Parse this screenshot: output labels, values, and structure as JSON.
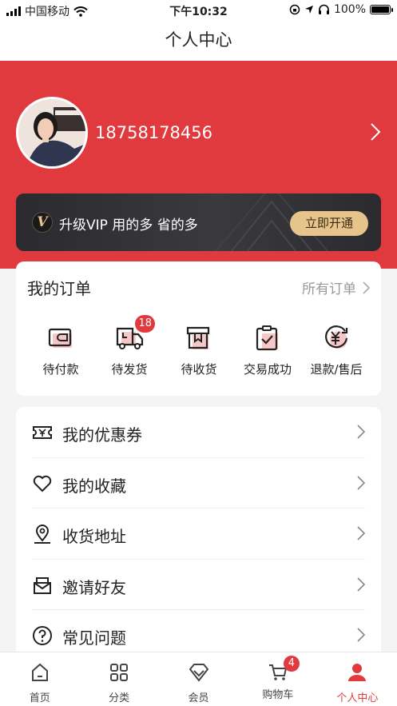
{
  "status_bar": {
    "carrier": "中国移动",
    "time": "下午10:32",
    "battery": "100%"
  },
  "nav": {
    "title": "个人中心"
  },
  "profile": {
    "phone": "18758178456"
  },
  "vip": {
    "logo": "V",
    "text": "升级VIP 用的多 省的多",
    "button": "立即开通"
  },
  "orders": {
    "title": "我的订单",
    "all_label": "所有订单",
    "items": [
      {
        "label": "待付款",
        "icon": "wallet-icon"
      },
      {
        "label": "待发货",
        "icon": "truck-icon",
        "badge": "18"
      },
      {
        "label": "待收货",
        "icon": "package-icon"
      },
      {
        "label": "交易成功",
        "icon": "clipboard-check-icon"
      },
      {
        "label": "退款/售后",
        "icon": "refund-icon"
      }
    ]
  },
  "menu": [
    {
      "label": "我的优惠券",
      "icon": "coupon-icon"
    },
    {
      "label": "我的收藏",
      "icon": "heart-icon"
    },
    {
      "label": "收货地址",
      "icon": "location-icon"
    },
    {
      "label": "邀请好友",
      "icon": "invite-icon"
    },
    {
      "label": "常见问题",
      "icon": "question-icon"
    }
  ],
  "tabbar": {
    "items": [
      {
        "label": "首页",
        "icon": "home-icon"
      },
      {
        "label": "分类",
        "icon": "category-icon"
      },
      {
        "label": "会员",
        "icon": "diamond-icon"
      },
      {
        "label": "购物车",
        "icon": "cart-icon",
        "badge": "4"
      },
      {
        "label": "个人中心",
        "icon": "user-icon",
        "active": true
      }
    ]
  },
  "colors": {
    "brand_red": "#e03a3e",
    "vip_gold": "#e7c48c",
    "vip_dark": "#2b2b2f"
  }
}
